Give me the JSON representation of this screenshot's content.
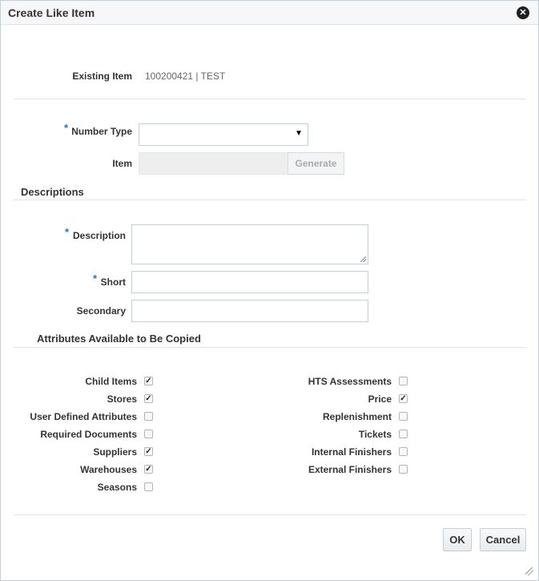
{
  "dialog": {
    "title": "Create Like Item",
    "close_glyph": "✕"
  },
  "existing_item": {
    "label": "Existing Item",
    "value": "100200421 | TEST"
  },
  "number_type": {
    "required_mark": "*",
    "label": "Number Type",
    "value": "",
    "arrow_glyph": "▼"
  },
  "item": {
    "label": "Item",
    "value": "",
    "generate_label": "Generate"
  },
  "descriptions": {
    "section_title": "Descriptions",
    "description": {
      "required_mark": "*",
      "label": "Description",
      "value": ""
    },
    "short": {
      "required_mark": "*",
      "label": "Short",
      "value": ""
    },
    "secondary": {
      "label": "Secondary",
      "value": ""
    }
  },
  "attributes": {
    "section_title": "Attributes Available to Be Copied",
    "left": [
      {
        "label": "Child Items",
        "checked": true
      },
      {
        "label": "Stores",
        "checked": true
      },
      {
        "label": "User Defined Attributes",
        "checked": false
      },
      {
        "label": "Required Documents",
        "checked": false
      },
      {
        "label": "Suppliers",
        "checked": true
      },
      {
        "label": "Warehouses",
        "checked": true
      },
      {
        "label": "Seasons",
        "checked": false
      }
    ],
    "right": [
      {
        "label": "HTS Assessments",
        "checked": false
      },
      {
        "label": "Price",
        "checked": true
      },
      {
        "label": "Replenishment",
        "checked": false
      },
      {
        "label": "Tickets",
        "checked": false
      },
      {
        "label": "Internal Finishers",
        "checked": false
      },
      {
        "label": "External Finishers",
        "checked": false
      }
    ]
  },
  "footer": {
    "ok_label": "OK",
    "cancel_label": "Cancel"
  },
  "colors": {
    "required": "#2f6fbd",
    "divider": "#dfe4e9",
    "disabled_field": "#eeeeee"
  }
}
